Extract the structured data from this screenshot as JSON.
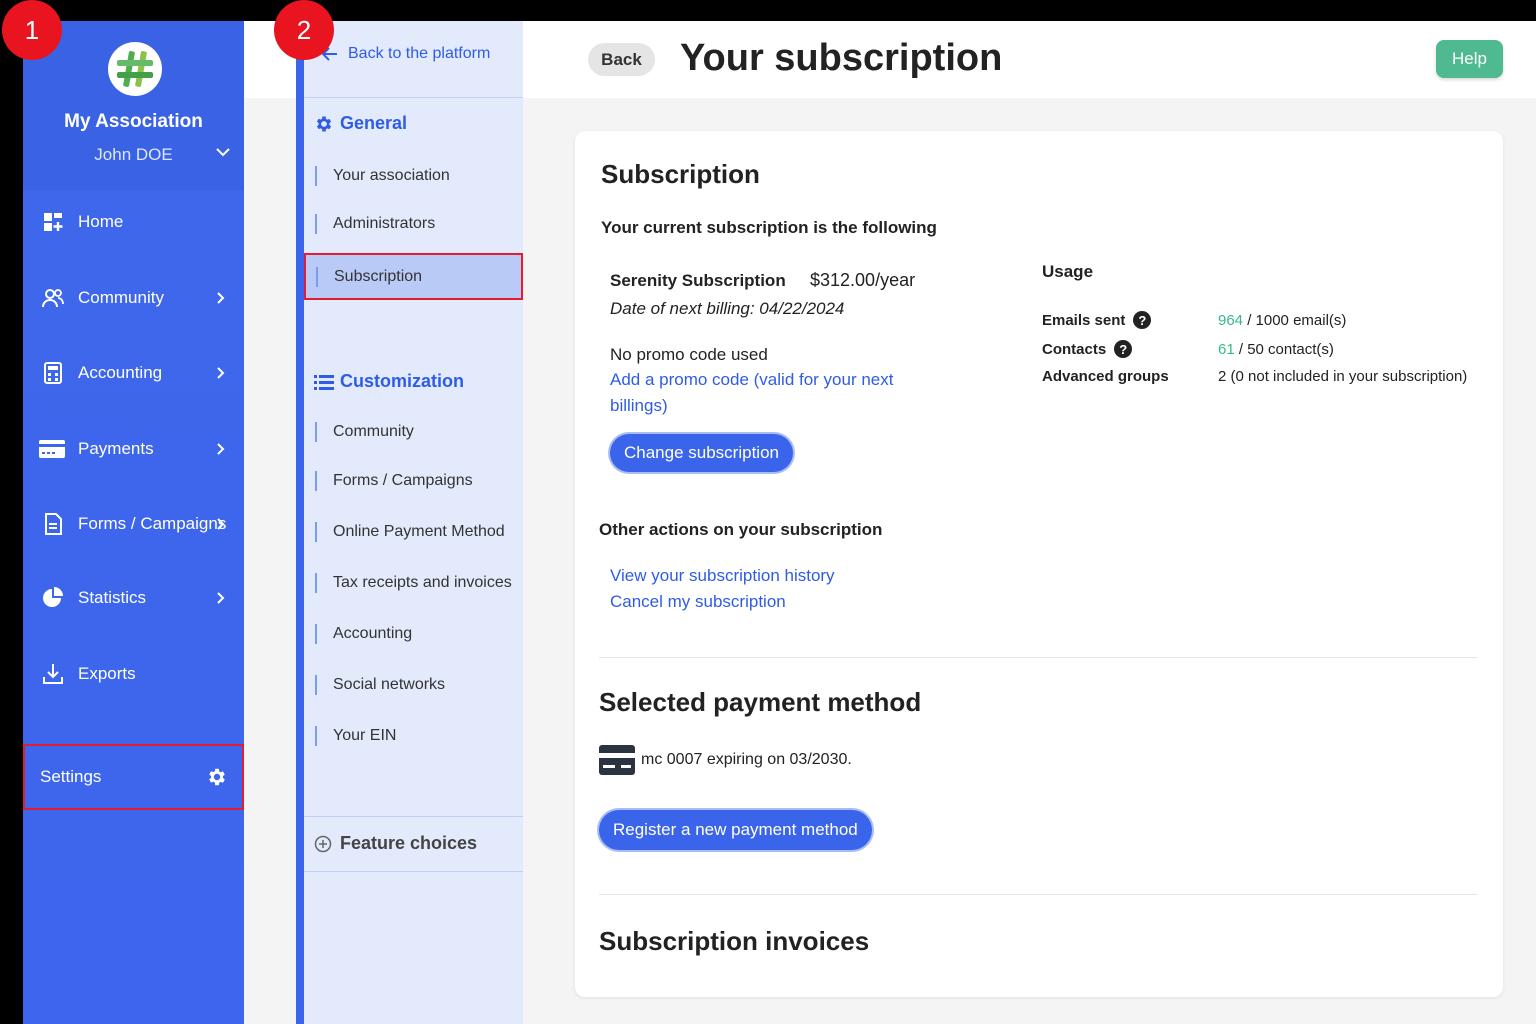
{
  "badges": {
    "step1": "1",
    "step2": "2"
  },
  "sidebar": {
    "org_name": "My Association",
    "user_name": "John DOE",
    "items": [
      {
        "label": "Home",
        "icon": "home-dashboard-icon"
      },
      {
        "label": "Community",
        "icon": "community-icon"
      },
      {
        "label": "Accounting",
        "icon": "accounting-icon"
      },
      {
        "label": "Payments",
        "icon": "payments-card-icon"
      },
      {
        "label": "Forms / Campaigns",
        "icon": "forms-document-icon"
      },
      {
        "label": "Statistics",
        "icon": "statistics-pie-icon"
      },
      {
        "label": "Exports",
        "icon": "exports-download-icon"
      }
    ],
    "settings_label": "Settings"
  },
  "subnav": {
    "back_label": "Back to the platform",
    "general_title": "General",
    "general_items": [
      "Your association",
      "Administrators",
      "Subscription"
    ],
    "custom_title": "Customization",
    "custom_items": [
      "Community",
      "Forms / Campaigns",
      "Online Payment Method",
      "Tax receipts and invoices",
      "Accounting",
      "Social networks",
      "Your EIN"
    ],
    "feature_choices": "Feature choices"
  },
  "header": {
    "back_label": "Back",
    "title": "Your subscription",
    "help_label": "Help"
  },
  "subscription": {
    "heading": "Subscription",
    "current_label": "Your current subscription is the following",
    "plan_name": "Serenity Subscription",
    "price": "$312.00/year",
    "next_billing": "Date of next billing: 04/22/2024",
    "promo_status": "No promo code used",
    "promo_link": "Add a promo code (valid for your next billings)",
    "change_button": "Change subscription",
    "usage_title": "Usage",
    "usage": [
      {
        "label": "Emails sent",
        "help": true,
        "used": "964",
        "rest": " / 1000 email(s)"
      },
      {
        "label": "Contacts",
        "help": true,
        "used": "61",
        "rest": " / 50 contact(s)"
      },
      {
        "label": "Advanced groups",
        "help": false,
        "used": "",
        "rest": "2 (0 not included in your subscription)"
      }
    ],
    "other_actions_title": "Other actions on your subscription",
    "history_link": "View your subscription history",
    "cancel_link": "Cancel my subscription"
  },
  "payment": {
    "heading": "Selected payment method",
    "card_text": "mc 0007 expiring on 03/2030.",
    "register_button": "Register a new payment method"
  },
  "invoices": {
    "heading": "Subscription invoices"
  },
  "colors": {
    "primary": "#3a64ea",
    "help": "#4fba8f",
    "usage_green": "#3ab886",
    "highlight": "#e21d2f"
  }
}
